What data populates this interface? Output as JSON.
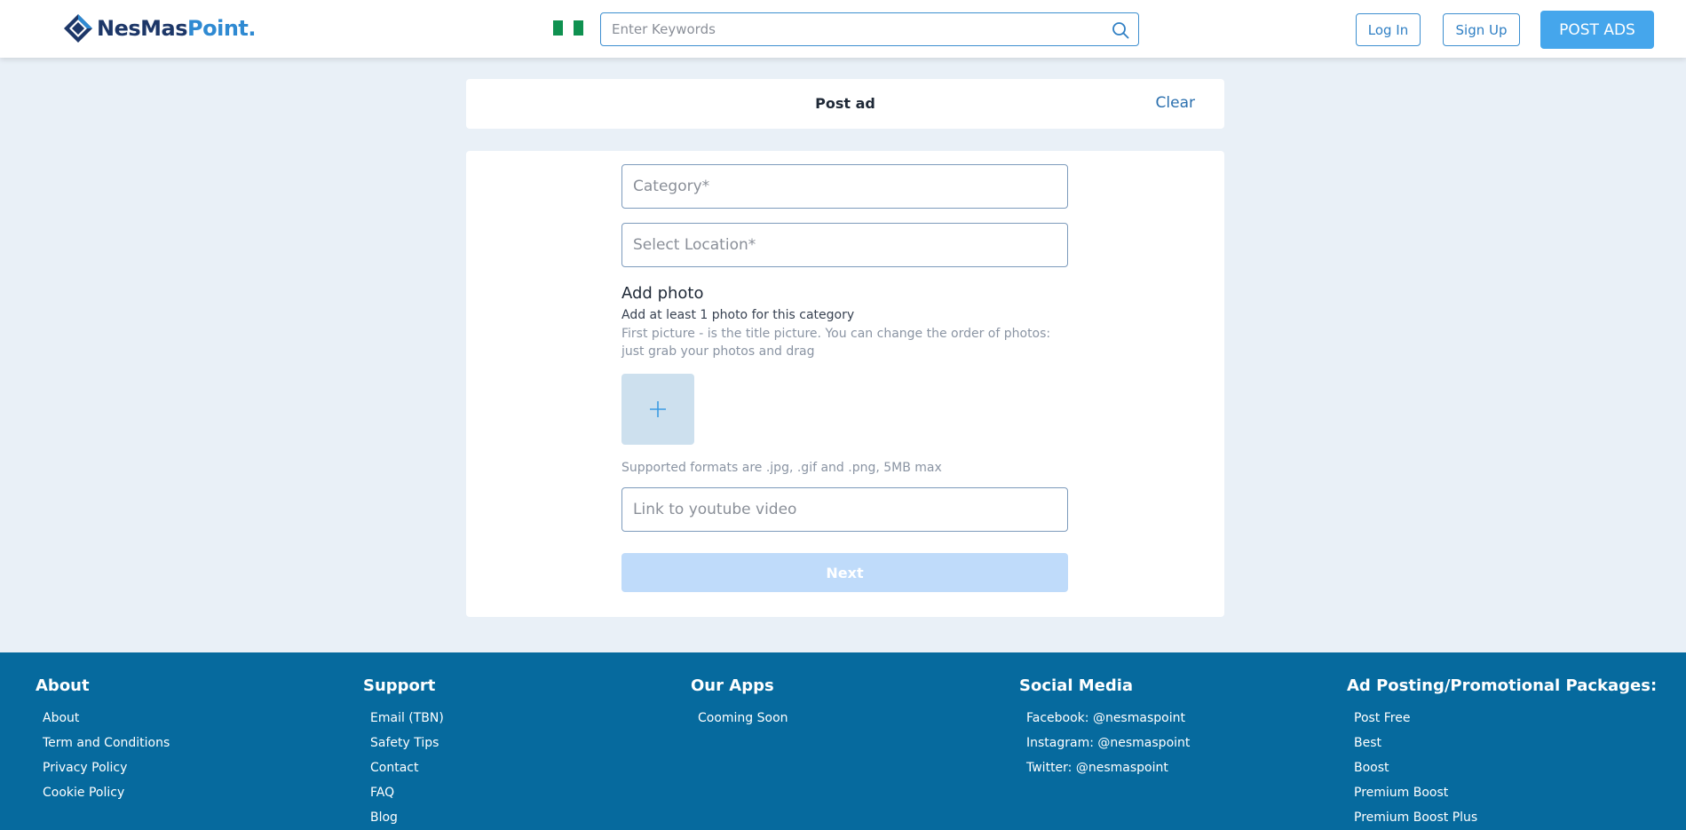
{
  "header": {
    "logo": {
      "text_main": "NesMas",
      "text_accent": "Point."
    },
    "search": {
      "placeholder": "Enter Keywords"
    },
    "login_label": "Log In",
    "signup_label": "Sign Up",
    "post_ads_label": "POST ADS"
  },
  "post_card": {
    "title": "Post ad",
    "clear_label": "Clear"
  },
  "form": {
    "category_placeholder": "Category*",
    "location_placeholder": "Select Location*",
    "add_photo_title": "Add photo",
    "add_photo_subtitle": "Add at least 1 photo for this category",
    "add_photo_hint": "First picture - is the title picture. You can change the order of photos: just grab your photos and drag",
    "supported_formats": "Supported formats are .jpg, .gif and .png, 5MB max",
    "youtube_placeholder": "Link to youtube video",
    "next_label": "Next"
  },
  "footer": {
    "about": {
      "heading": "About",
      "items": [
        "About",
        "Term and Conditions",
        "Privacy Policy",
        "Cookie Policy"
      ]
    },
    "support": {
      "heading": "Support",
      "items": [
        "Email (TBN)",
        "Safety Tips",
        "Contact",
        "FAQ",
        "Blog"
      ]
    },
    "apps": {
      "heading": "Our Apps",
      "items": [
        "Cooming Soon"
      ]
    },
    "social": {
      "heading": "Social Media",
      "items": [
        "Facebook: @nesmaspoint",
        "Instagram: @nesmaspoint",
        "Twitter: @nesmaspoint"
      ]
    },
    "packages": {
      "heading": "Ad Posting/Promotional Packages:",
      "items": [
        "Post Free",
        "Best",
        "Boost",
        "Premium Boost",
        "Premium Boost Plus"
      ]
    }
  },
  "colors": {
    "brand_dark": "#1d3768",
    "brand_accent": "#2f8ad2",
    "primary_button": "#45a6ec",
    "footer_bg": "#066a9e",
    "page_bg": "#e9f0f7"
  },
  "icons": {
    "logo": "diamond-logo-icon",
    "flag": "nigeria-flag-icon",
    "search": "search-icon",
    "add_photo": "plus-icon"
  }
}
